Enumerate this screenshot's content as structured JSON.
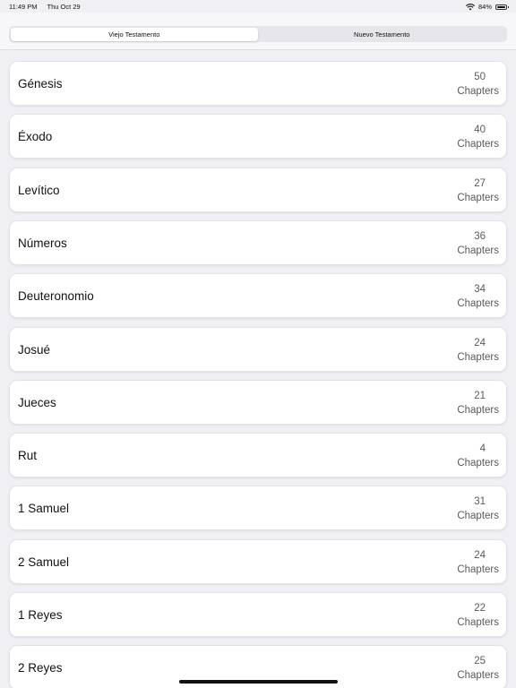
{
  "status_bar": {
    "time": "11:49 PM",
    "date": "Thu Oct 29",
    "battery_text": "84%",
    "battery_level": 0.84
  },
  "segments": [
    {
      "label": "Viejo Testamento",
      "active": true
    },
    {
      "label": "Nuevo Testamento",
      "active": false
    }
  ],
  "books": [
    {
      "name": "Génesis",
      "count": "50",
      "unit": "Chapters"
    },
    {
      "name": "Éxodo",
      "count": "40",
      "unit": "Chapters"
    },
    {
      "name": "Levítico",
      "count": "27",
      "unit": "Chapters"
    },
    {
      "name": "Números",
      "count": "36",
      "unit": "Chapters"
    },
    {
      "name": "Deuteronomio",
      "count": "34",
      "unit": "Chapters"
    },
    {
      "name": "Josué",
      "count": "24",
      "unit": "Chapters"
    },
    {
      "name": "Jueces",
      "count": "21",
      "unit": "Chapters"
    },
    {
      "name": "Rut",
      "count": "4",
      "unit": "Chapters"
    },
    {
      "name": "1 Samuel",
      "count": "31",
      "unit": "Chapters"
    },
    {
      "name": "2 Samuel",
      "count": "24",
      "unit": "Chapters"
    },
    {
      "name": "1 Reyes",
      "count": "22",
      "unit": "Chapters"
    },
    {
      "name": "2 Reyes",
      "count": "25",
      "unit": "Chapters"
    }
  ]
}
